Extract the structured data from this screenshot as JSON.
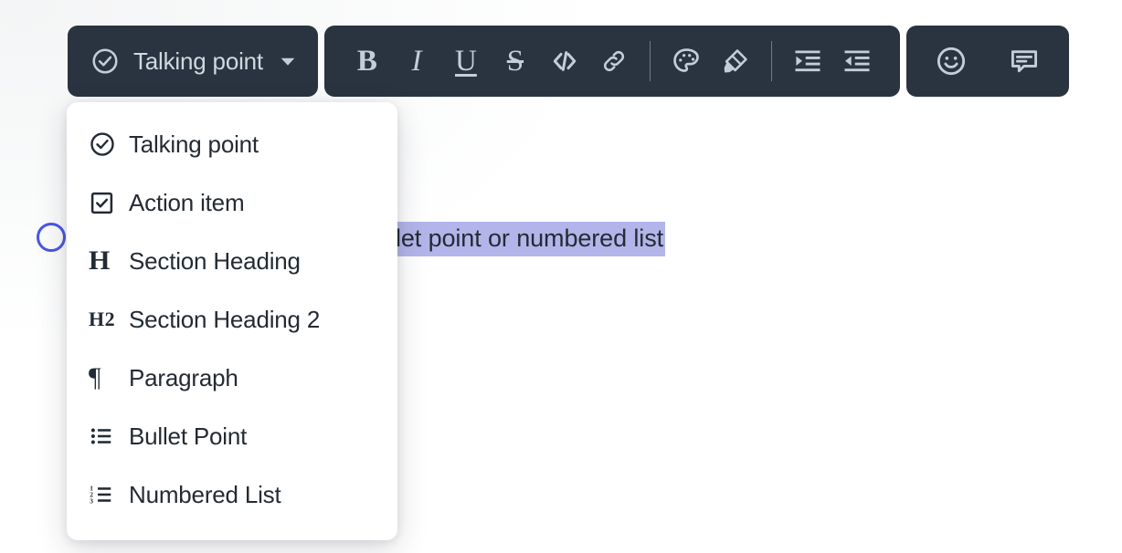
{
  "document": {
    "bullet_icon": "talking-point-circle-icon",
    "bullet_color": "#4c57e3",
    "line_text": "this can be changed to a bullet point or numbered list",
    "selection_color": "#b3b5ea",
    "text_color": "#232b33"
  },
  "toolbar": {
    "background": "#293440",
    "icon_color": "#c2cfd8",
    "block_type": {
      "label": "Talking point",
      "leading_icon": "check-circle-icon",
      "trailing_icon": "chevron-down-icon"
    },
    "format_buttons": [
      {
        "name": "bold-button",
        "glyph": "B",
        "style": "bold"
      },
      {
        "name": "italic-button",
        "glyph": "I",
        "style": "italic"
      },
      {
        "name": "underline-button",
        "glyph": "U",
        "style": "underline"
      },
      {
        "name": "strikethrough-button",
        "glyph": "S",
        "style": "strike"
      },
      {
        "name": "code-button",
        "glyph": "</>",
        "style": "code"
      },
      {
        "name": "link-button",
        "glyph": "",
        "style": "icon-link"
      }
    ],
    "color_buttons": [
      {
        "name": "text-color-button",
        "glyph": "",
        "style": "icon-palette"
      },
      {
        "name": "highlight-button",
        "glyph": "",
        "style": "icon-highlighter"
      }
    ],
    "indent_buttons": [
      {
        "name": "indent-increase-button",
        "glyph": "",
        "style": "icon-indent-increase"
      },
      {
        "name": "indent-decrease-button",
        "glyph": "",
        "style": "icon-indent-decrease"
      }
    ],
    "extra_buttons": [
      {
        "name": "emoji-button",
        "glyph": "",
        "style": "icon-smiley"
      },
      {
        "name": "comment-button",
        "glyph": "",
        "style": "icon-comment"
      }
    ]
  },
  "dropdown": {
    "items": [
      {
        "label": "Talking point",
        "icon": "check-circle-icon"
      },
      {
        "label": "Action item",
        "icon": "checkbox-checked-icon"
      },
      {
        "label": "Section Heading",
        "icon": "heading-1-icon"
      },
      {
        "label": "Section Heading 2",
        "icon": "heading-2-icon"
      },
      {
        "label": "Paragraph",
        "icon": "pilcrow-icon"
      },
      {
        "label": "Bullet Point",
        "icon": "bullet-list-icon"
      },
      {
        "label": "Numbered List",
        "icon": "numbered-list-icon"
      }
    ]
  }
}
